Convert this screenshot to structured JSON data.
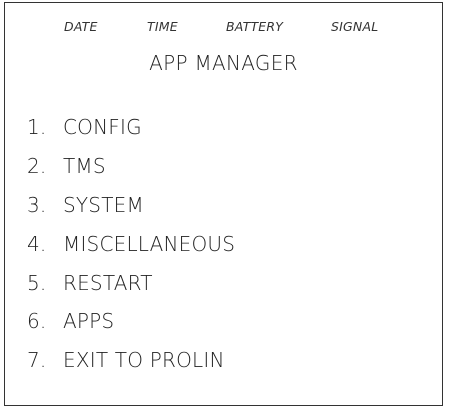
{
  "status_bar": {
    "date_label": "DATE",
    "time_label": "TIME",
    "battery_label": "BATTERY",
    "signal_label": "SIGNAL"
  },
  "title": "APP MANAGER",
  "menu": {
    "items": [
      {
        "number": "1.",
        "label": "CONFIG"
      },
      {
        "number": "2.",
        "label": "TMS"
      },
      {
        "number": "3.",
        "label": "SYSTEM"
      },
      {
        "number": "4.",
        "label": "MISCELLANEOUS"
      },
      {
        "number": "5.",
        "label": "RESTART"
      },
      {
        "number": "6.",
        "label": "APPS"
      },
      {
        "number": "7.",
        "label": "EXIT TO PROLIN"
      }
    ]
  },
  "colors": {
    "background": "#ffffff",
    "text": "#222222",
    "border": "#333333"
  }
}
